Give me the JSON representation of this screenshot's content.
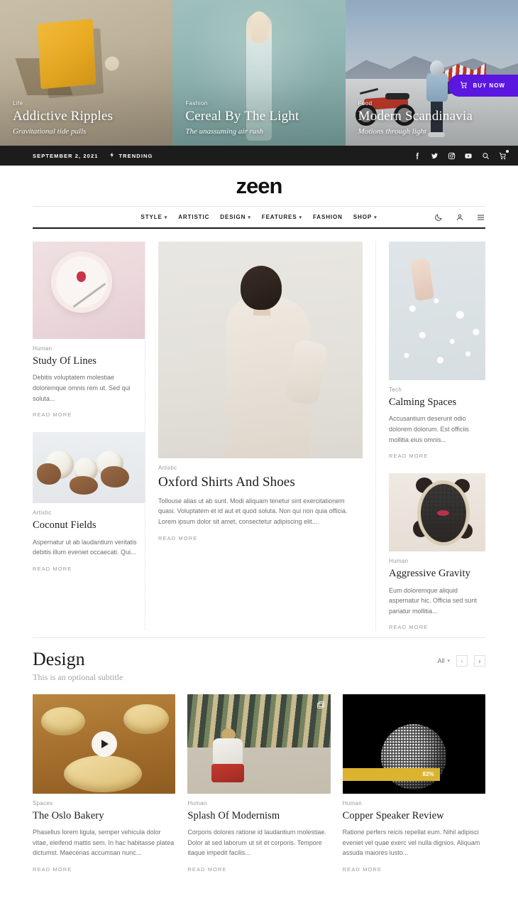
{
  "hero": {
    "slides": [
      {
        "category": "Life",
        "title": "Addictive Ripples",
        "subtitle": "Gravitational tide pulls"
      },
      {
        "category": "Fashion",
        "title": "Cereal By The Light",
        "subtitle": "The unassuming air rush"
      },
      {
        "category": "Food",
        "title": "Modern Scandinavia",
        "subtitle": "Motions through light"
      }
    ],
    "buy_button": {
      "label": "BUY NOW",
      "icon": "cart-icon",
      "color": "#5b16e0"
    }
  },
  "topbar": {
    "date": "SEPTEMBER 2, 2021",
    "trending": "TRENDING",
    "trending_icon": "bolt-icon",
    "background": "#1c1c1c",
    "icons": [
      "facebook-icon",
      "twitter-icon",
      "instagram-icon",
      "youtube-icon",
      "search-icon",
      "cart-icon"
    ]
  },
  "brand": {
    "name": "zeen"
  },
  "nav": {
    "items": [
      {
        "label": "STYLE",
        "has_dropdown": true
      },
      {
        "label": "ARTISTIC",
        "has_dropdown": false
      },
      {
        "label": "DESIGN",
        "has_dropdown": true
      },
      {
        "label": "FEATURES",
        "has_dropdown": true
      },
      {
        "label": "FASHION",
        "has_dropdown": false
      },
      {
        "label": "SHOP",
        "has_dropdown": true
      }
    ],
    "icons": [
      "moon-icon",
      "user-icon",
      "hamburger-icon"
    ]
  },
  "grid": {
    "read_more": "READ MORE",
    "left": [
      {
        "category": "Human",
        "title": "Study Of Lines",
        "excerpt": "Debitis voluptatem molestiae doloremque omnis rem ut. Sed qui soluta..."
      },
      {
        "category": "Artistic",
        "title": "Coconut Fields",
        "excerpt": "Aspernatur ut ab laudantium veritatis debitis illum eveniet occaecati. Qui..."
      }
    ],
    "middle": {
      "category": "Artistic",
      "title": "Oxford Shirts And Shoes",
      "excerpt": "Tollouse alias ut ab sunt. Modi aliquam tenetur sint exercitationem quasi. Voluptatem et id aut et quod soluta. Non qui non quia officia. Lorem ipsum dolor sit amet, consectetur adipiscing elit...."
    },
    "right": [
      {
        "category": "Tech",
        "title": "Calming Spaces",
        "excerpt": "Accusantium deserunt odio dolorem dolorum. Est officiis mollitia eius omnis..."
      },
      {
        "category": "Human",
        "title": "Aggressive Gravity",
        "excerpt": "Eum doloremque aliquid aspernatur hic. Officia sed sunt pariatur mollitia..."
      }
    ]
  },
  "section": {
    "title": "Design",
    "subtitle": "This is an optional subtitle",
    "filter_label": "All",
    "prev_label": "‹",
    "next_label": "›",
    "read_more": "READ MORE",
    "cards": [
      {
        "category": "Spaces",
        "title": "The Oslo Bakery",
        "excerpt": "Phasellus lorem ligula, semper vehicula dolor vitae, eleifend mattis sem. In hac habitasse platea dictumst. Maecenas accumsan nunc...",
        "media_badge": "play-icon"
      },
      {
        "category": "Human",
        "title": "Splash Of Modernism",
        "excerpt": "Corporis dolores ratione id laudantium molestiae. Dolor at sed laborum ut sit et corporis. Tempore itaque impedit facilis...",
        "media_badge": "gallery-icon"
      },
      {
        "category": "Human",
        "title": "Copper Speaker Review",
        "excerpt": "Ratione perfers reicis repellat eum. Nihil adipisci eveniet vel quae exerc vel nulla dignios. Aliquam assuda maiores iusto...",
        "score": "82%",
        "score_color": "#dbb32e"
      }
    ]
  }
}
